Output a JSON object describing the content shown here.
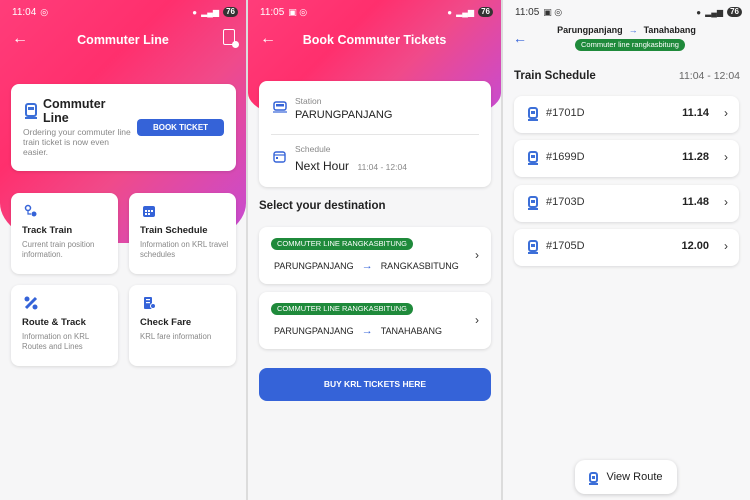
{
  "colors": {
    "accent": "#3563d8",
    "green": "#1f8a3b",
    "hero": "#ff3d7a"
  },
  "status": {
    "s1": {
      "time": "11:04",
      "battery": "76"
    },
    "s2": {
      "time": "11:05",
      "battery": "76"
    },
    "s3": {
      "time": "11:05",
      "battery": "76"
    }
  },
  "screen1": {
    "title": "Commuter Line",
    "card": {
      "title": "Commuter Line",
      "desc": "Ordering your commuter line train ticket is now even easier.",
      "button": "BOOK TICKET"
    },
    "features": [
      {
        "title": "Track Train",
        "desc": "Current train position information.",
        "icon": "track-icon"
      },
      {
        "title": "Train Schedule",
        "desc": "Information on KRL travel schedules",
        "icon": "calendar-icon"
      },
      {
        "title": "Route & Track",
        "desc": "Information on KRL Routes and Lines",
        "icon": "route-icon"
      },
      {
        "title": "Check Fare",
        "desc": "KRL fare information",
        "icon": "fare-icon"
      }
    ]
  },
  "screen2": {
    "title": "Book Commuter Tickets",
    "station_label": "Station",
    "station_value": "PARUNGPANJANG",
    "schedule_label": "Schedule",
    "schedule_value": "Next Hour",
    "schedule_range": "11:04 - 12:04",
    "dest_title": "Select your destination",
    "routes": [
      {
        "badge": "COMMUTER LINE RANGKASBITUNG",
        "from": "PARUNGPANJANG",
        "to": "RANGKASBITUNG"
      },
      {
        "badge": "COMMUTER LINE RANGKASBITUNG",
        "from": "PARUNGPANJANG",
        "to": "TANAHABANG"
      }
    ],
    "buy_button": "BUY KRL TICKETS HERE"
  },
  "screen3": {
    "from": "Parungpanjang",
    "to": "Tanahabang",
    "badge": "Commuter line rangkasbitung",
    "title": "Train Schedule",
    "range": "11:04 - 12:04",
    "rows": [
      {
        "num": "#1701D",
        "time": "11.14"
      },
      {
        "num": "#1699D",
        "time": "11.28"
      },
      {
        "num": "#1703D",
        "time": "11.48"
      },
      {
        "num": "#1705D",
        "time": "12.00"
      }
    ],
    "view_button": "View Route"
  }
}
